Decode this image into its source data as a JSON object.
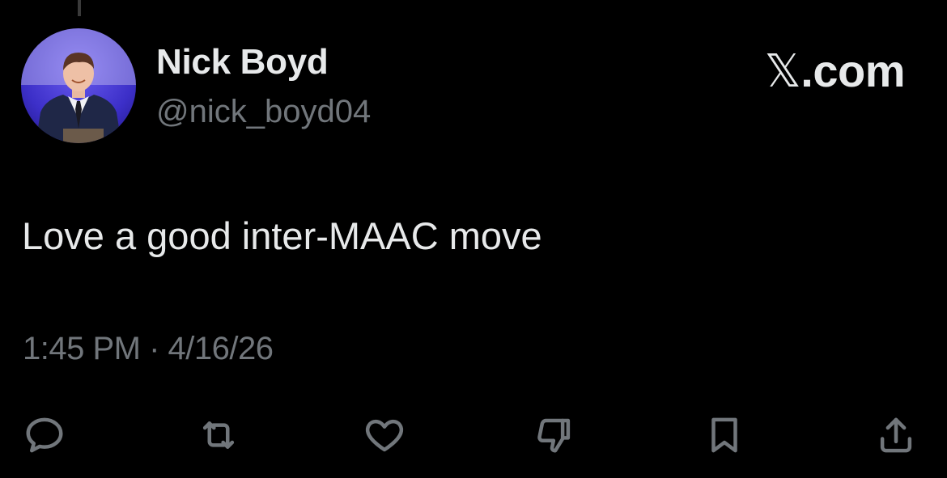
{
  "author": {
    "display_name": "Nick Boyd",
    "handle": "@nick_boyd04",
    "avatar_icon": "profile-photo"
  },
  "brand": {
    "glyph": "𝕏",
    "text": ".com"
  },
  "tweet": {
    "text": "Love a good inter-MAAC move",
    "timestamp": "1:45 PM · 4/16/26"
  },
  "actions": [
    {
      "name": "reply",
      "icon": "reply-icon"
    },
    {
      "name": "retweet",
      "icon": "retweet-icon"
    },
    {
      "name": "like",
      "icon": "heart-icon"
    },
    {
      "name": "dislike",
      "icon": "thumbs-down-icon"
    },
    {
      "name": "bookmark",
      "icon": "bookmark-icon"
    },
    {
      "name": "share",
      "icon": "share-icon"
    }
  ],
  "colors": {
    "background": "#000000",
    "primary_text": "#e7e9ea",
    "secondary_text": "#71767b",
    "avatar_bg": "#4b3fd8"
  }
}
